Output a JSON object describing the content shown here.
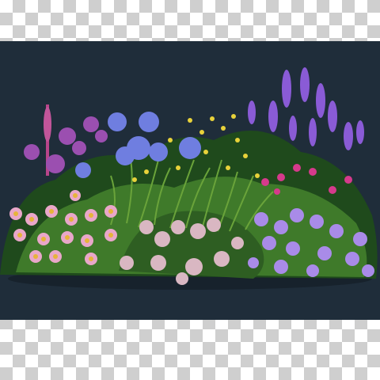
{
  "image": {
    "background": "transparent-checkerboard",
    "panel_color": "#1f2d3a",
    "subject": "flower-bed",
    "colors": {
      "foliage_dark": "#1f4a1c",
      "foliage_mid": "#3f7a2a",
      "foliage_light": "#6aa33a",
      "lavender": "#8a5bd6",
      "agapanthus": "#6f7ee0",
      "aster_pink": "#e9a7c9",
      "aster_center": "#e7b43a",
      "yellow": "#e8d23a",
      "magenta": "#d63a8c",
      "pink_white": "#d9b7c2",
      "violet_petal": "#a98be8"
    }
  }
}
